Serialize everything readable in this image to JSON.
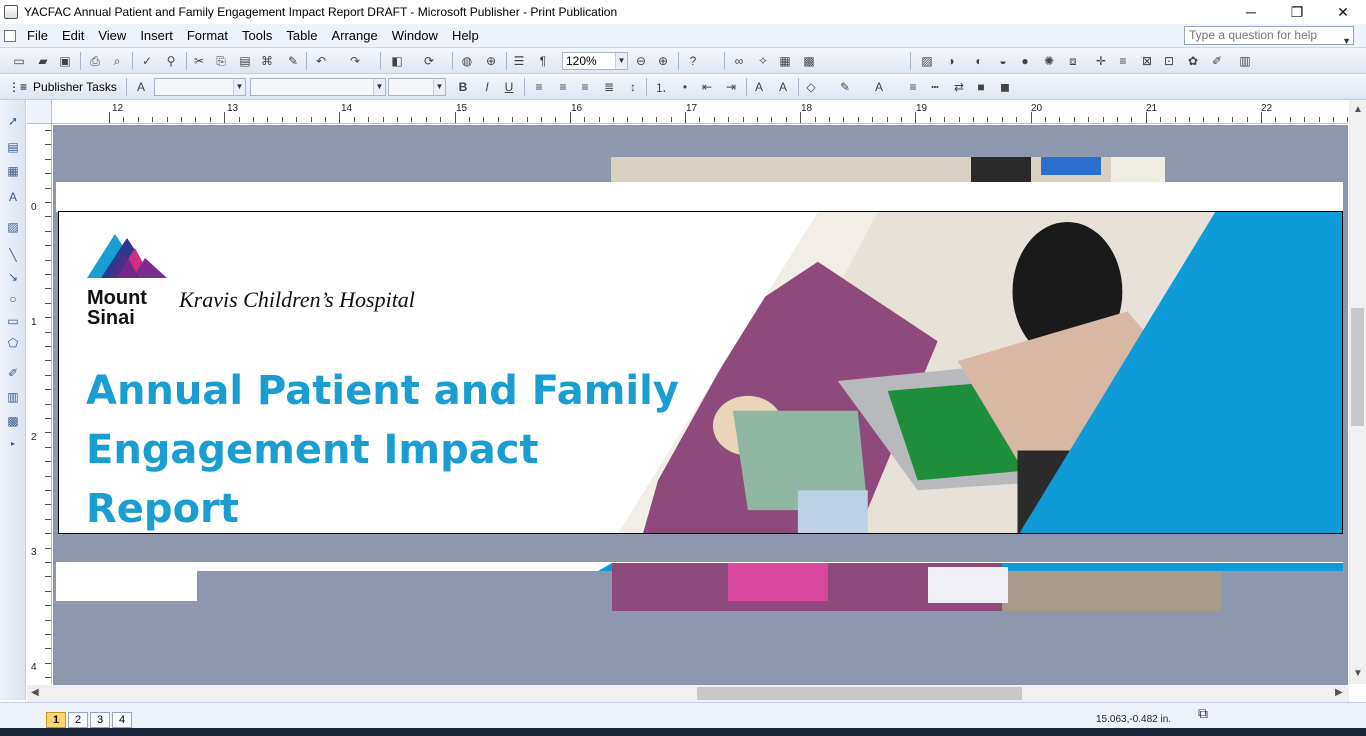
{
  "window": {
    "title": "YACFAC Annual Patient and Family Engagement Impact Report DRAFT - Microsoft Publisher - Print Publication",
    "minimize": "─",
    "restore": "❐",
    "close": "✕"
  },
  "menu": {
    "items": [
      "File",
      "Edit",
      "View",
      "Insert",
      "Format",
      "Tools",
      "Table",
      "Arrange",
      "Window",
      "Help"
    ],
    "help_placeholder": "Type a question for help"
  },
  "toolbar": {
    "zoom": "120%",
    "publisher_tasks": "Publisher Tasks"
  },
  "ruler": {
    "top_numbers": [
      "12",
      "13",
      "14",
      "15",
      "16",
      "17",
      "18",
      "19",
      "20",
      "21",
      "22"
    ],
    "left_numbers": [
      "0",
      "1",
      "2",
      "3",
      "4"
    ]
  },
  "banner": {
    "logo_name_line1": "Mount",
    "logo_name_line2": "Sinai",
    "hospital": "Kravis Children’s Hospital",
    "title_line1": "Annual Patient and Family",
    "title_line2": "Engagement Impact Report",
    "accent_color": "#1a9dd1",
    "photo_panel_color": "#0f9bd7"
  },
  "status": {
    "pages": [
      "1",
      "2",
      "3",
      "4"
    ],
    "active_page": "1",
    "coordinates": "15.063,-0.482 in."
  }
}
